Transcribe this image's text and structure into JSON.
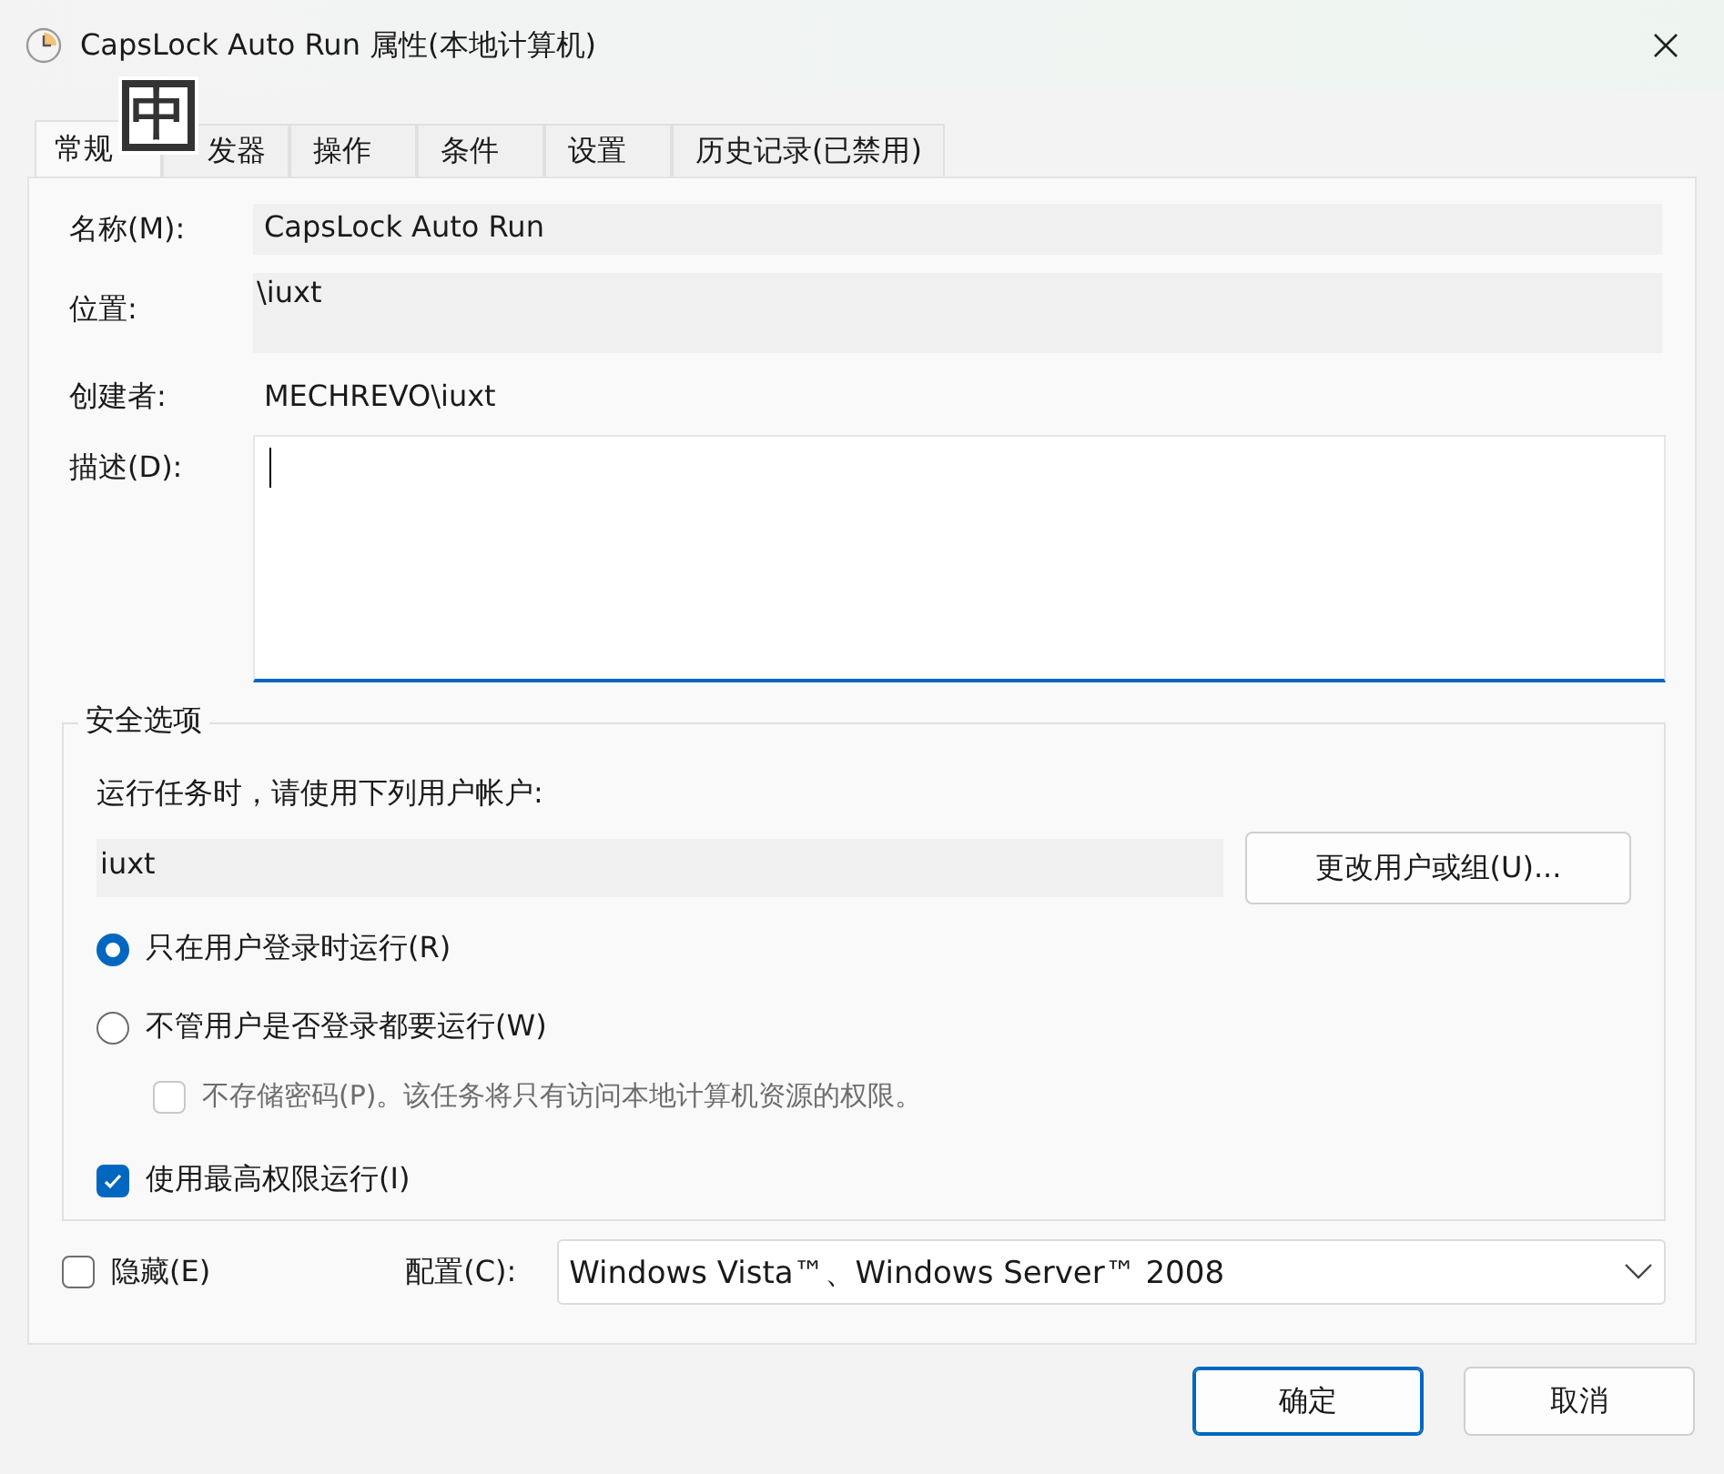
{
  "window": {
    "title": "CapsLock Auto Run 属性(本地计算机)"
  },
  "ime_indicator": "中",
  "tabs": [
    {
      "label": "常规",
      "selected": true
    },
    {
      "label": "发器",
      "selected": false
    },
    {
      "label": "操作",
      "selected": false
    },
    {
      "label": "条件",
      "selected": false
    },
    {
      "label": "设置",
      "selected": false
    },
    {
      "label": "历史记录(已禁用)",
      "selected": false
    }
  ],
  "general": {
    "name": {
      "label": "名称(M):",
      "value": "CapsLock Auto Run"
    },
    "location": {
      "label": "位置:",
      "value": "\\iuxt"
    },
    "author": {
      "label": "创建者:",
      "value": "MECHREVO\\iuxt"
    },
    "description": {
      "label": "描述(D):",
      "focused": true
    }
  },
  "security": {
    "title": "安全选项",
    "account_label": "运行任务时，请使用下列用户帐户:",
    "account": "iuxt",
    "change_button": "更改用户或组(U)...",
    "options": [
      {
        "kind": "radio",
        "label": "只在用户登录时运行(R)",
        "selected": true
      },
      {
        "kind": "radio",
        "label": "不管用户是否登录都要运行(W)",
        "selected": false,
        "children": [
          {
            "kind": "checkbox",
            "label": "不存储密码(P)。该任务将只有访问本地计算机资源的权限。",
            "checked": false,
            "disabled": true
          }
        ]
      },
      {
        "kind": "checkbox",
        "label": "使用最高权限运行(I)",
        "checked": true,
        "disabled": false
      }
    ]
  },
  "hidden": {
    "label": "隐藏(E)",
    "checked": false
  },
  "configure": {
    "label": "配置(C):",
    "value": "Windows Vista™、Windows Server™ 2008"
  },
  "buttons": [
    {
      "label": "确定",
      "default": true
    },
    {
      "label": "取消",
      "default": false
    }
  ]
}
